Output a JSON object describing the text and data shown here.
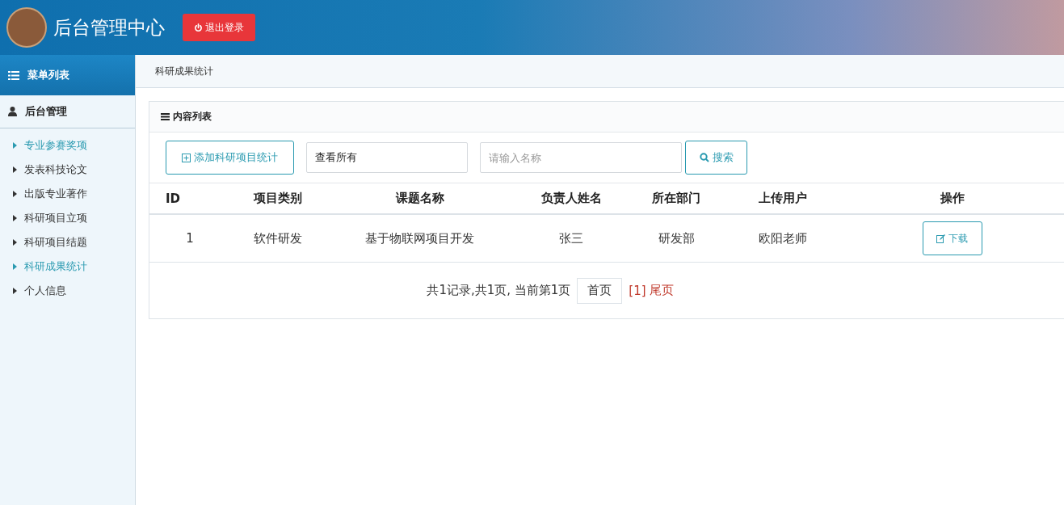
{
  "header": {
    "title": "后台管理中心",
    "logout_button": "退出登录"
  },
  "sidebar": {
    "title": "菜单列表",
    "section": "后台管理",
    "items": [
      {
        "label": "专业参赛奖项",
        "selected": true
      },
      {
        "label": "发表科技论文",
        "selected": false
      },
      {
        "label": "出版专业著作",
        "selected": false
      },
      {
        "label": "科研项目立项",
        "selected": false
      },
      {
        "label": "科研项目结题",
        "selected": false
      },
      {
        "label": "科研成果统计",
        "selected": true
      },
      {
        "label": "个人信息",
        "selected": false
      }
    ]
  },
  "breadcrumb": "科研成果统计",
  "panel": {
    "title": "内容列表",
    "add_button": "添加科研项目统计",
    "filter_value": "查看所有",
    "search_placeholder": "请输入名称",
    "search_button": "搜索"
  },
  "table": {
    "columns": [
      "ID",
      "项目类别",
      "课题名称",
      "负责人姓名",
      "所在部门",
      "上传用户",
      "操作"
    ],
    "rows": [
      {
        "cells": [
          "1",
          "软件研发",
          "基于物联网项目开发",
          "张三",
          "研发部",
          "欧阳老师"
        ],
        "action": "下载"
      }
    ]
  },
  "pagination": {
    "summary": "共1记录,共1页, 当前第1页",
    "first": "首页",
    "current": "[1]",
    "last": "尾页"
  }
}
